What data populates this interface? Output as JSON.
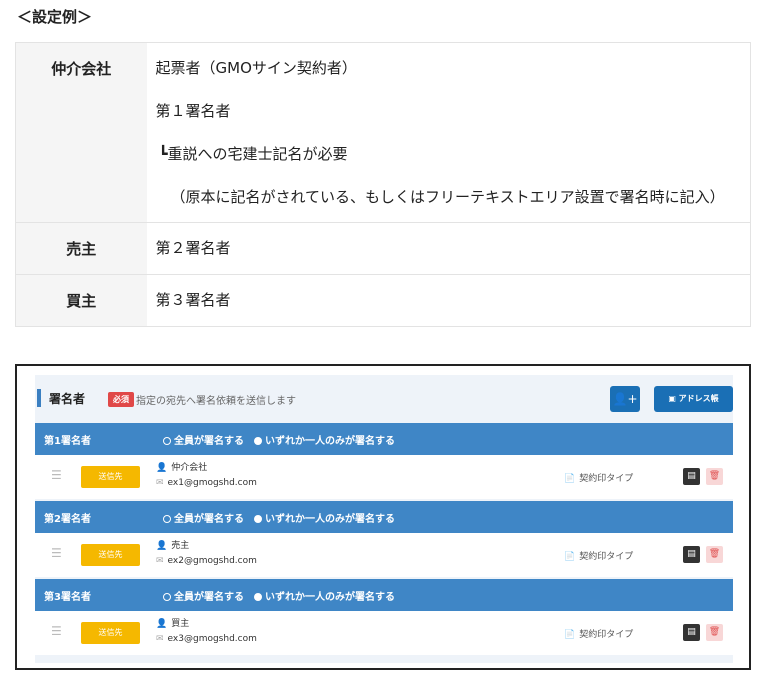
{
  "heading": "＜設定例＞",
  "table": {
    "rows": [
      {
        "label": "仲介会社",
        "lines": [
          "起票者（GMOサイン契約者）",
          "第１署名者",
          "┗重説への宅建士記名が必要",
          "（原本に記名がされている、もしくはフリーテキストエリア設置で署名時に記入）"
        ]
      },
      {
        "label": "売主",
        "lines": [
          "第２署名者"
        ]
      },
      {
        "label": "買主",
        "lines": [
          "第３署名者"
        ]
      }
    ]
  },
  "panel": {
    "title": "署名者",
    "required_badge": "必須",
    "description": "指定の宛先へ署名依頼を送信します",
    "add_signer_icon": "add-user-icon",
    "address_book_label": "アドレス帳",
    "option_all": "全員が署名する",
    "option_any": "いずれか一人のみが署名する",
    "send_label": "送信先",
    "stamp_label": "契約印タイプ",
    "groups": [
      {
        "name": "第1署名者",
        "user": "仲介会社",
        "email": "ex1@gmogshd.com"
      },
      {
        "name": "第2署名者",
        "user": "売主",
        "email": "ex2@gmogshd.com"
      },
      {
        "name": "第3署名者",
        "user": "買主",
        "email": "ex3@gmogshd.com"
      }
    ]
  }
}
